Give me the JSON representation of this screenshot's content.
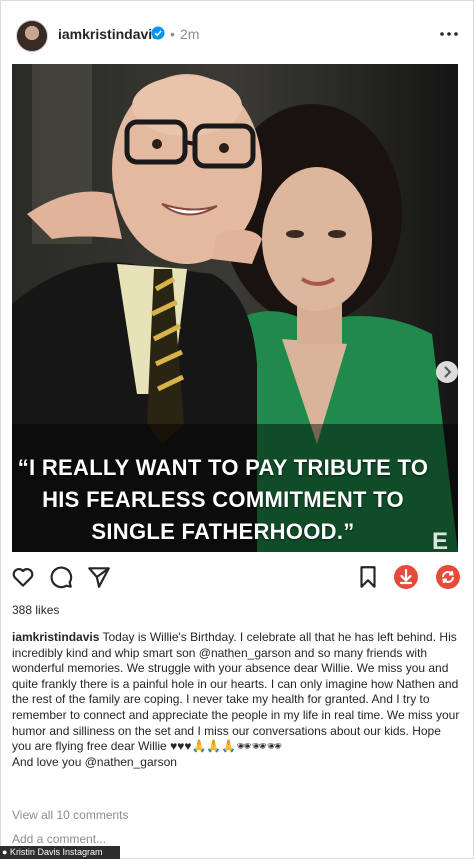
{
  "post": {
    "username": "iamkristindavis",
    "dot": "•",
    "time": "2m",
    "quote_lines": [
      "“I REALLY WANT TO PAY TRIBUTE TO",
      "HIS FEARLESS COMMITMENT TO",
      "SINGLE FATHERHOOD.”"
    ],
    "photo_mark": "E"
  },
  "icons": {
    "verified": "verified-badge-icon",
    "more": "more-options-icon",
    "next": "next-arrow-icon",
    "like": "heart-icon",
    "comment": "comment-icon",
    "share": "share-icon",
    "save": "bookmark-icon",
    "download": "download-icon",
    "repost": "repost-icon"
  },
  "colors": {
    "accent": "#0095f6",
    "download_red": "#e84a3a",
    "photo_green": "#1f8a4c"
  },
  "likes": "388 likes",
  "caption": {
    "username": "iamkristindavis",
    "text": " Today is Willie's Birthday. I celebrate all that he has left behind. His incredibly kind and whip smart son @nathen_garson and so many friends with wonderful memories. We struggle with your absence dear Willie. We miss you and quite frankly there is a painful hole in our hearts. I can only imagine how Nathen and the rest of the family are coping. I never take my health for granted. And I try to remember to connect and appreciate the people in my life in real time. We miss your humor and silliness on the set and I miss our conversations about our kids. Hope you are flying free dear Willie ♥♥♥🙏🙏🙏🕶🕶🕶",
    "last_line": "And love you @nathen_garson"
  },
  "view_all": "View all 10 comments",
  "add_comment": "Add a comment...",
  "credit": "● Kristin Davis Instagram"
}
